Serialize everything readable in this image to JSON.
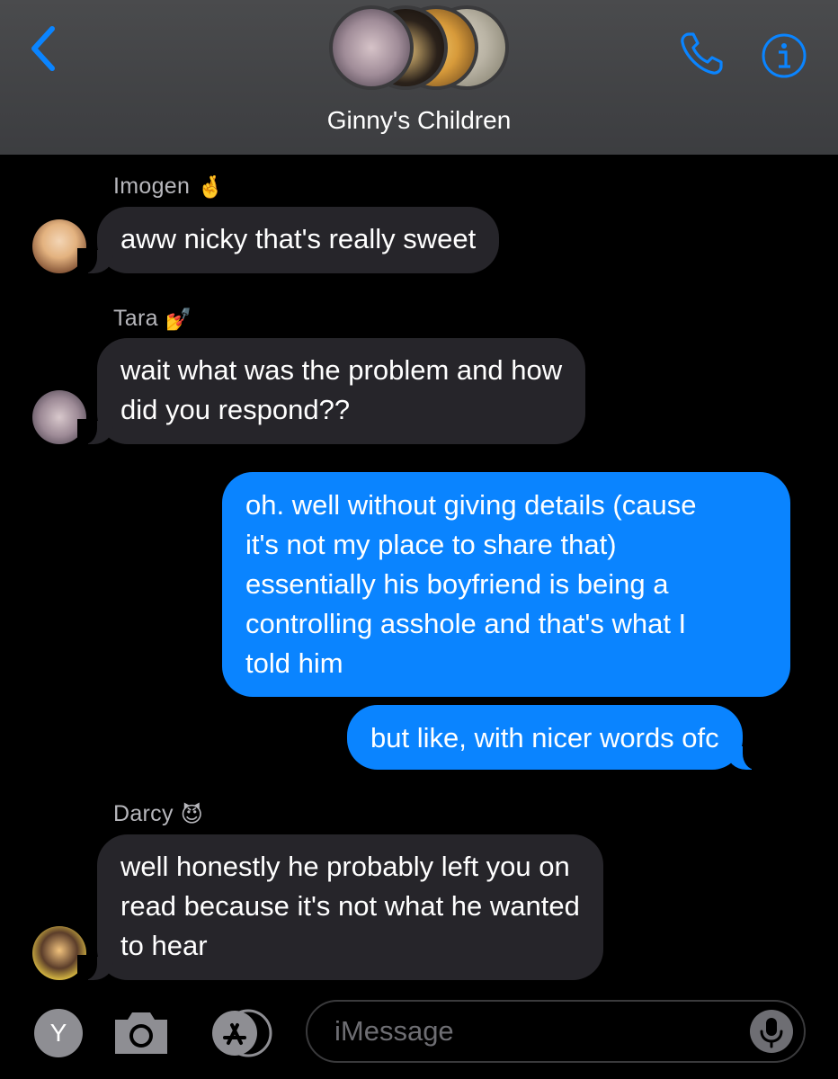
{
  "header": {
    "title": "Ginny's Children",
    "back_icon": "chevron-left-icon",
    "call_icon": "phone-icon",
    "info_icon": "info-icon",
    "accent_color": "#0a84ff"
  },
  "messages": [
    {
      "sender": "Imogen",
      "sender_emoji": "🤞",
      "direction": "incoming",
      "text": "aww nicky that's really sweet"
    },
    {
      "sender": "Tara",
      "sender_emoji": "💅",
      "direction": "incoming",
      "text": "wait what was the problem and how\ndid you respond??"
    },
    {
      "direction": "outgoing",
      "text": "oh. well without giving details (cause\nit's not my place to share that)\nessentially his boyfriend is being a\ncontrolling asshole and that's what I\ntold him"
    },
    {
      "direction": "outgoing",
      "text": "but like, with nicer words ofc"
    },
    {
      "sender": "Darcy",
      "sender_emoji": "😈",
      "direction": "incoming",
      "text": "well honestly he probably left you on\nread because it's not what he wanted\nto hear"
    }
  ],
  "input_bar": {
    "apps_letter": "Y",
    "placeholder": "iMessage",
    "camera_icon": "camera-icon",
    "appstore_icon": "app-store-icon",
    "mic_icon": "microphone-icon"
  }
}
